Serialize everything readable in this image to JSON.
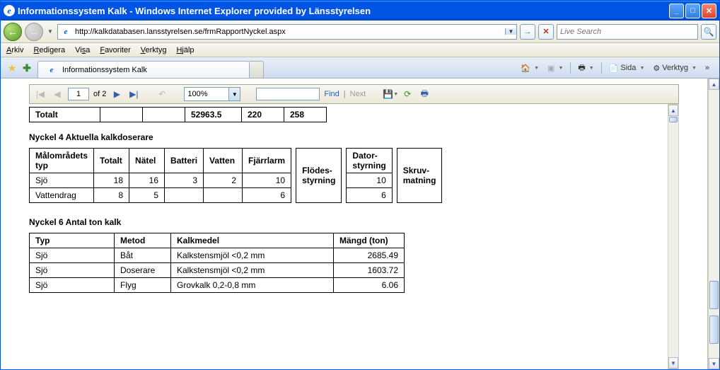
{
  "titlebar": {
    "title": "Informationssystem Kalk - Windows Internet Explorer provided by Länsstyrelsen"
  },
  "address": {
    "url": "http://kalkdatabasen.lansstyrelsen.se/frmRapportNyckel.aspx"
  },
  "search": {
    "placeholder": "Live Search"
  },
  "menu": {
    "arkiv": "Arkiv",
    "redigera": "Redigera",
    "visa": "Visa",
    "favoriter": "Favoriter",
    "verktyg": "Verktyg",
    "hjalp": "Hjälp"
  },
  "tab": {
    "title": "Informationssystem Kalk"
  },
  "cmdbar": {
    "sida": "Sida",
    "verktyg": "Verktyg"
  },
  "report_toolbar": {
    "page": "1",
    "of": "of 2",
    "zoom": "100%",
    "find": "Find",
    "next": "Next"
  },
  "totals_row": {
    "label": "Totalt",
    "c1": "52963.5",
    "c2": "220",
    "c3": "258"
  },
  "section4_title": "Nyckel 4 Aktuella kalkdoserare",
  "table4": {
    "headers": [
      "Målområdets typ",
      "Totalt",
      "Nätel",
      "Batteri",
      "Vatten",
      "Fjärrlarm",
      "Flödes-styrning",
      "Dator-styrning",
      "Skruv-matning"
    ],
    "rows": [
      {
        "label": "Sjö",
        "totalt": "18",
        "natel": "16",
        "batteri": "3",
        "vatten": "2",
        "fjarrlarm": "10",
        "flodes": "",
        "dator": "10",
        "skruv": ""
      },
      {
        "label": "Vattendrag",
        "totalt": "8",
        "natel": "5",
        "batteri": "",
        "vatten": "",
        "fjarrlarm": "6",
        "flodes": "",
        "dator": "6",
        "skruv": ""
      }
    ]
  },
  "section6_title": "Nyckel 6 Antal ton kalk",
  "table6": {
    "headers": [
      "Typ",
      "Metod",
      "Kalkmedel",
      "Mängd (ton)"
    ],
    "rows": [
      {
        "typ": "Sjö",
        "metod": "Båt",
        "kalkmedel": "Kalkstensmjöl <0,2 mm",
        "mangd": "2685.49"
      },
      {
        "typ": "Sjö",
        "metod": "Doserare",
        "kalkmedel": "Kalkstensmjöl <0,2 mm",
        "mangd": "1603.72"
      },
      {
        "typ": "Sjö",
        "metod": "Flyg",
        "kalkmedel": "Grovkalk 0,2-0,8 mm",
        "mangd": "6.06"
      }
    ]
  }
}
